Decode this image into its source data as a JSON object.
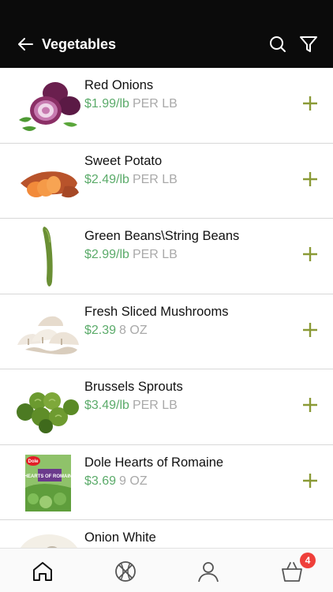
{
  "header": {
    "title": "Vegetables"
  },
  "products": [
    {
      "name": "Red Onions",
      "price": "$1.99/lb",
      "unit": "PER LB"
    },
    {
      "name": "Sweet Potato",
      "price": "$2.49/lb",
      "unit": "PER LB"
    },
    {
      "name": "Green Beans\\String Beans",
      "price": "$2.99/lb",
      "unit": "PER LB"
    },
    {
      "name": "Fresh Sliced Mushrooms",
      "price": "$2.39",
      "unit": "8 OZ"
    },
    {
      "name": "Brussels Sprouts",
      "price": "$3.49/lb",
      "unit": "PER LB"
    },
    {
      "name": "Dole Hearts of Romaine",
      "price": "$3.69",
      "unit": "9 OZ",
      "package_brand": "Dole",
      "package_label": "HEARTS OF ROMAINE"
    },
    {
      "name": "Onion White",
      "price": "",
      "unit": ""
    }
  ],
  "tabbar": {
    "tabs": [
      "home-icon",
      "basketball-icon",
      "user-icon",
      "cart-icon"
    ],
    "cart_badge": "4"
  },
  "colors": {
    "header_bg": "#0b0b0b",
    "price_green": "#5bab6a",
    "add_olive": "#8a9a36",
    "unit_gray": "#a9a9a9",
    "badge_red": "#ef3f3a"
  }
}
